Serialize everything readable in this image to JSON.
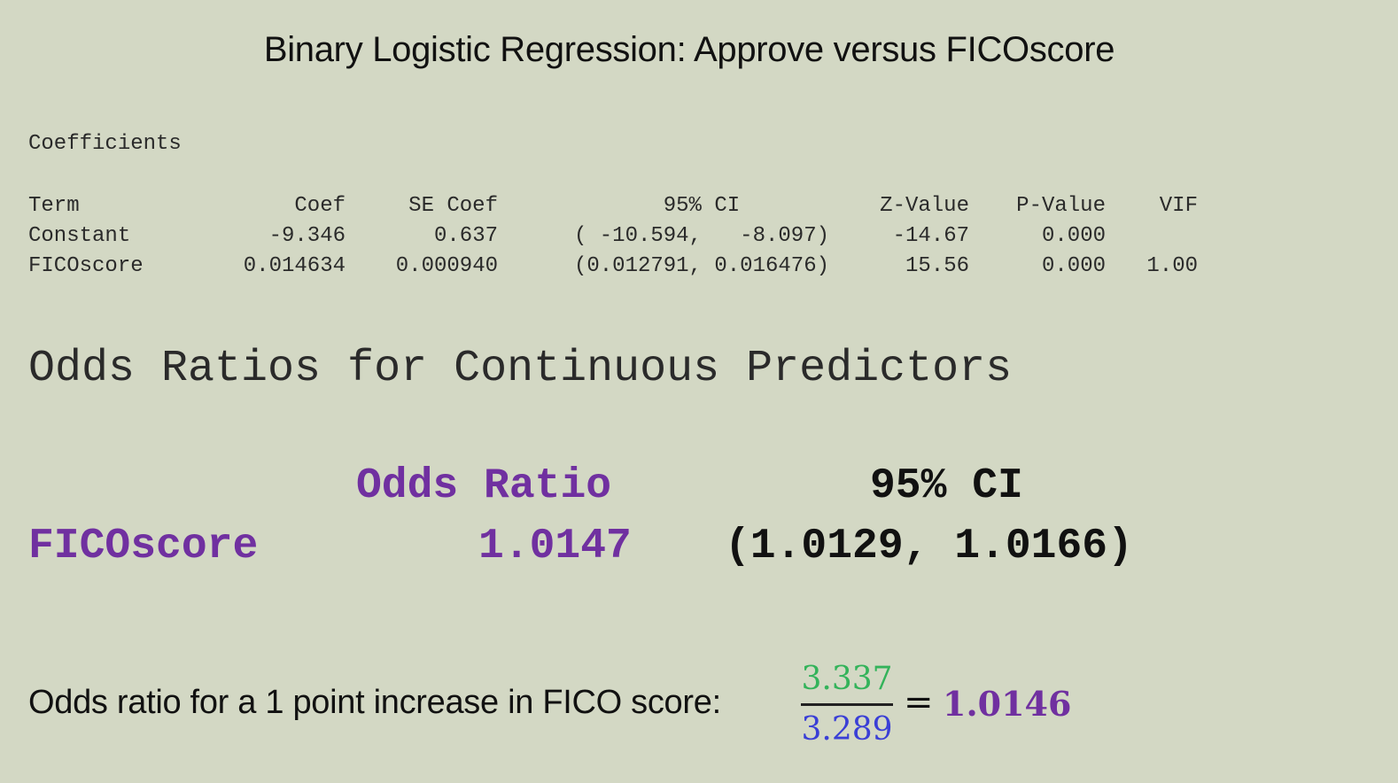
{
  "title": "Binary Logistic Regression: Approve versus FICOscore",
  "coefficients": {
    "heading": "Coefficients",
    "columns": [
      "Term",
      "Coef",
      "SE Coef",
      "95% CI",
      "Z-Value",
      "P-Value",
      "VIF"
    ],
    "rows": [
      [
        "Constant",
        "-9.346",
        "0.637",
        "( -10.594,   -8.097)",
        "-14.67",
        "0.000",
        ""
      ],
      [
        "FICOscore",
        "0.014634",
        "0.000940",
        "(0.012791, 0.016476)",
        "15.56",
        "0.000",
        "1.00"
      ]
    ]
  },
  "odds_ratios": {
    "heading": "Odds Ratios for Continuous Predictors",
    "col_ratio": "Odds Ratio",
    "col_ci": "95% CI",
    "term": "FICOscore",
    "value": "1.0147",
    "ci": "(1.0129, 1.0166)"
  },
  "formula": {
    "text": "Odds ratio for a 1 point increase in FICO score:",
    "numerator": "3.337",
    "denominator": "3.289",
    "equals": "=",
    "result": "1.0146"
  },
  "colors": {
    "background": "#d3d8c4",
    "purple": "#7030a0",
    "green": "#33b35a",
    "blue": "#3a3fd6"
  }
}
